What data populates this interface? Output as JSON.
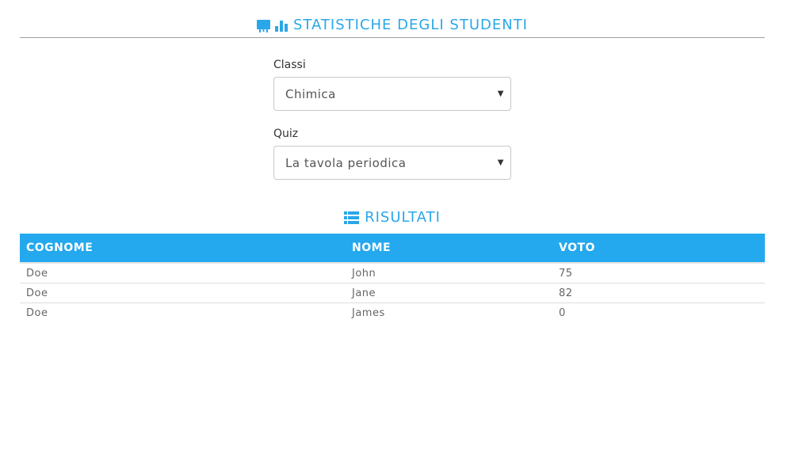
{
  "header": {
    "title": "STATISTICHE DEGLI STUDENTI",
    "icons": [
      "presentation-icon",
      "bar-chart-icon"
    ],
    "accent_color": "#2aa7e8"
  },
  "form": {
    "class_label": "Classi",
    "class_value": "Chimica",
    "quiz_label": "Quiz",
    "quiz_value": "La tavola periodica"
  },
  "results": {
    "title": "RISULTATI",
    "icon": "list-icon",
    "header_color": "#24a8ee",
    "columns": [
      "COGNOME",
      "NOME",
      "VOTO"
    ],
    "rows": [
      [
        "Doe",
        "John",
        "75"
      ],
      [
        "Doe",
        "Jane",
        "82"
      ],
      [
        "Doe",
        "James",
        "0"
      ]
    ]
  }
}
